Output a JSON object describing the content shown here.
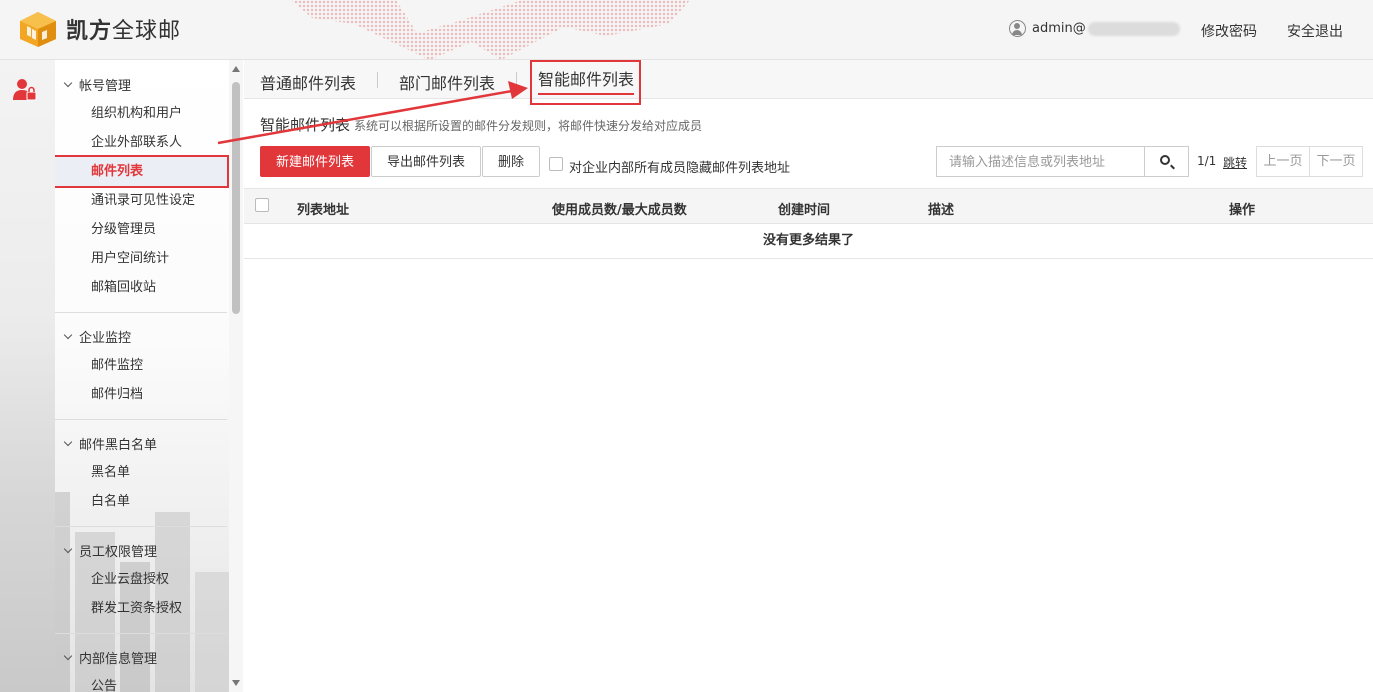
{
  "app": {
    "brand_bold": "凯方",
    "brand_rest": "全球邮"
  },
  "header": {
    "user_prefix": "admin@",
    "change_password": "修改密码",
    "logout": "安全退出"
  },
  "sidebar": {
    "groups": [
      {
        "title": "帐号管理",
        "items": [
          "组织机构和用户",
          "企业外部联系人",
          "邮件列表",
          "通讯录可见性设定",
          "分级管理员",
          "用户空间统计",
          "邮箱回收站"
        ]
      },
      {
        "title": "企业监控",
        "items": [
          "邮件监控",
          "邮件归档"
        ]
      },
      {
        "title": "邮件黑白名单",
        "items": [
          "黑名单",
          "白名单"
        ]
      },
      {
        "title": "员工权限管理",
        "items": [
          "企业云盘授权",
          "群发工资条授权"
        ]
      },
      {
        "title": "内部信息管理",
        "items": [
          "公告"
        ]
      }
    ],
    "active_item": "邮件列表"
  },
  "tabs": [
    "普通邮件列表",
    "部门邮件列表",
    "智能邮件列表"
  ],
  "active_tab": "智能邮件列表",
  "content": {
    "title": "智能邮件列表",
    "subtitle": "系统可以根据所设置的邮件分发规则，将邮件快速分发给对应成员"
  },
  "toolbar": {
    "new_button": "新建邮件列表",
    "export_button": "导出邮件列表",
    "delete_button": "删除",
    "hide_checkbox_label": "对企业内部所有成员隐藏邮件列表地址",
    "search_placeholder": "请输入描述信息或列表地址",
    "page": "1/1",
    "jump": "跳转",
    "prev": "上一页",
    "next": "下一页"
  },
  "table": {
    "columns": [
      "列表地址",
      "使用成员数/最大成员数",
      "创建时间",
      "描述",
      "操作"
    ],
    "empty_text": "没有更多结果了"
  },
  "colors": {
    "accent": "#e1373b",
    "logo": "#f0a020"
  }
}
